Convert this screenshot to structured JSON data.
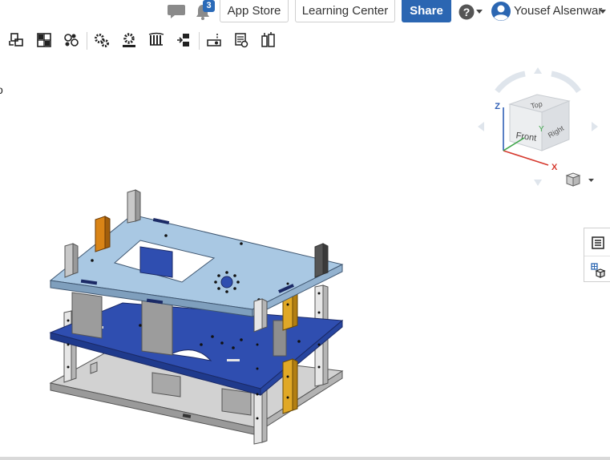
{
  "header": {
    "notification_count": "3",
    "app_store_label": "App Store",
    "learning_center_label": "Learning Center",
    "share_label": "Share",
    "user_name": "Yousef Alsenwar",
    "icons": [
      "chat-icon",
      "bell-icon",
      "help-icon",
      "avatar-icon"
    ]
  },
  "toolbar": {
    "tools": [
      "insert-icon",
      "assembly-grid-icon",
      "linked-parts-icon",
      "gears-icon",
      "gear-mate-icon",
      "rack-icon",
      "replicate-icon",
      "slot-icon",
      "pattern-icon",
      "explode-icon"
    ]
  },
  "viewcube": {
    "face_top": "Top",
    "face_front": "Front",
    "face_right": "Right",
    "axis_x": "X",
    "axis_y": "Y",
    "axis_z": "Z"
  },
  "side_panel": {
    "icons": [
      "instances-list-icon",
      "mate-features-icon"
    ]
  },
  "colors": {
    "share_button": "#2b66b2",
    "top_plate": "#a9c8e3",
    "middle_plate": "#2f4eb0",
    "base_plate": "#c9c9c9",
    "orange_standoff": "#d98416",
    "yellow_standoff": "#e0a826",
    "axis_x": "#d63a2f",
    "axis_y": "#3fa64a",
    "axis_z": "#2f5fb5"
  }
}
